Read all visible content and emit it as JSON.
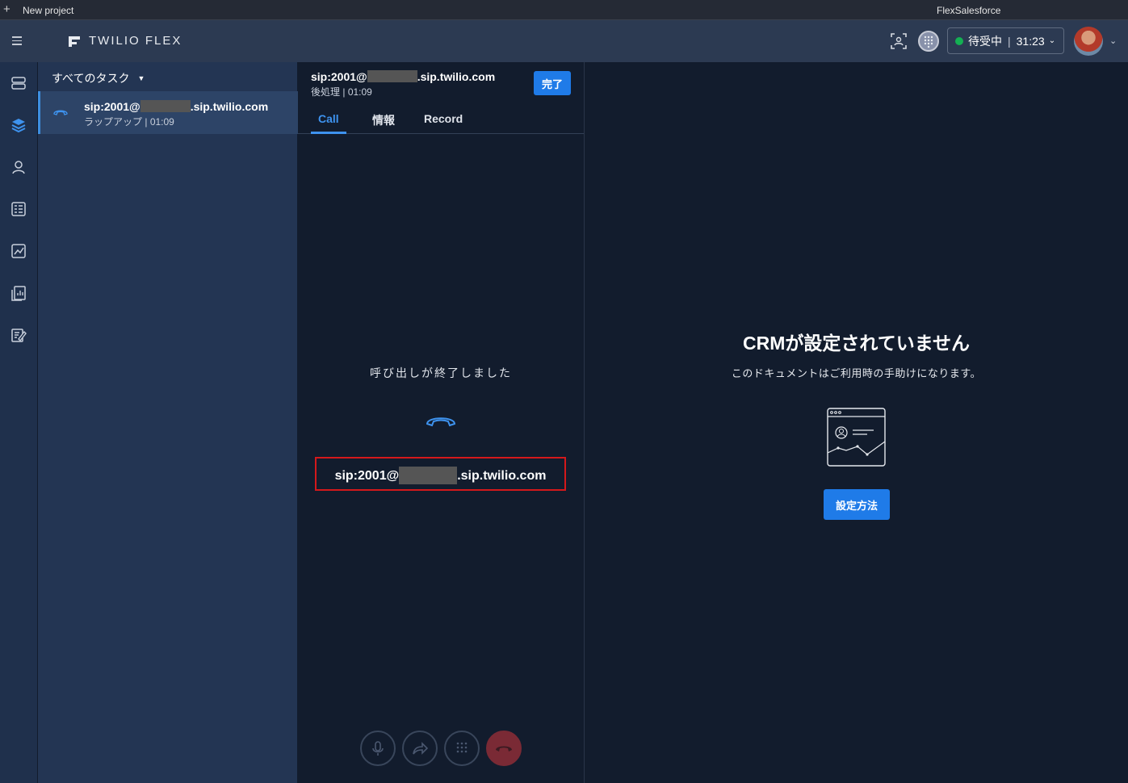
{
  "titlebar": {
    "new_project": "New project",
    "app_name": "FlexSalesforce"
  },
  "header": {
    "brand": "TWILIO FLEX",
    "status": {
      "label": "待受中",
      "time": "31:23",
      "color": "#14b053"
    }
  },
  "sidenav": {
    "items": [
      "agents-icon",
      "layers-icon",
      "contact-icon",
      "teams-icon",
      "analytics-icon",
      "reports-icon",
      "edit-icon"
    ]
  },
  "tasklist": {
    "filter": "すべてのタスク",
    "task": {
      "sip_prefix": "sip:2001@",
      "sip_suffix": ".sip.twilio.com",
      "status": "ラップアップ",
      "time": "01:09"
    }
  },
  "call": {
    "sip_prefix": "sip:2001@",
    "sip_suffix": ".sip.twilio.com",
    "status": "後処理",
    "time": "01:09",
    "done_label": "完了",
    "tabs": [
      "Call",
      "情報",
      "Record"
    ],
    "ended_text": "呼び出しが終了しました"
  },
  "crm": {
    "title": "CRMが設定されていません",
    "subtitle": "このドキュメントはご利用時の手助けになります。",
    "button": "設定方法"
  },
  "colors": {
    "accent": "#1f7be8",
    "highlight": "#d4181b",
    "bg": "#121c2d"
  }
}
